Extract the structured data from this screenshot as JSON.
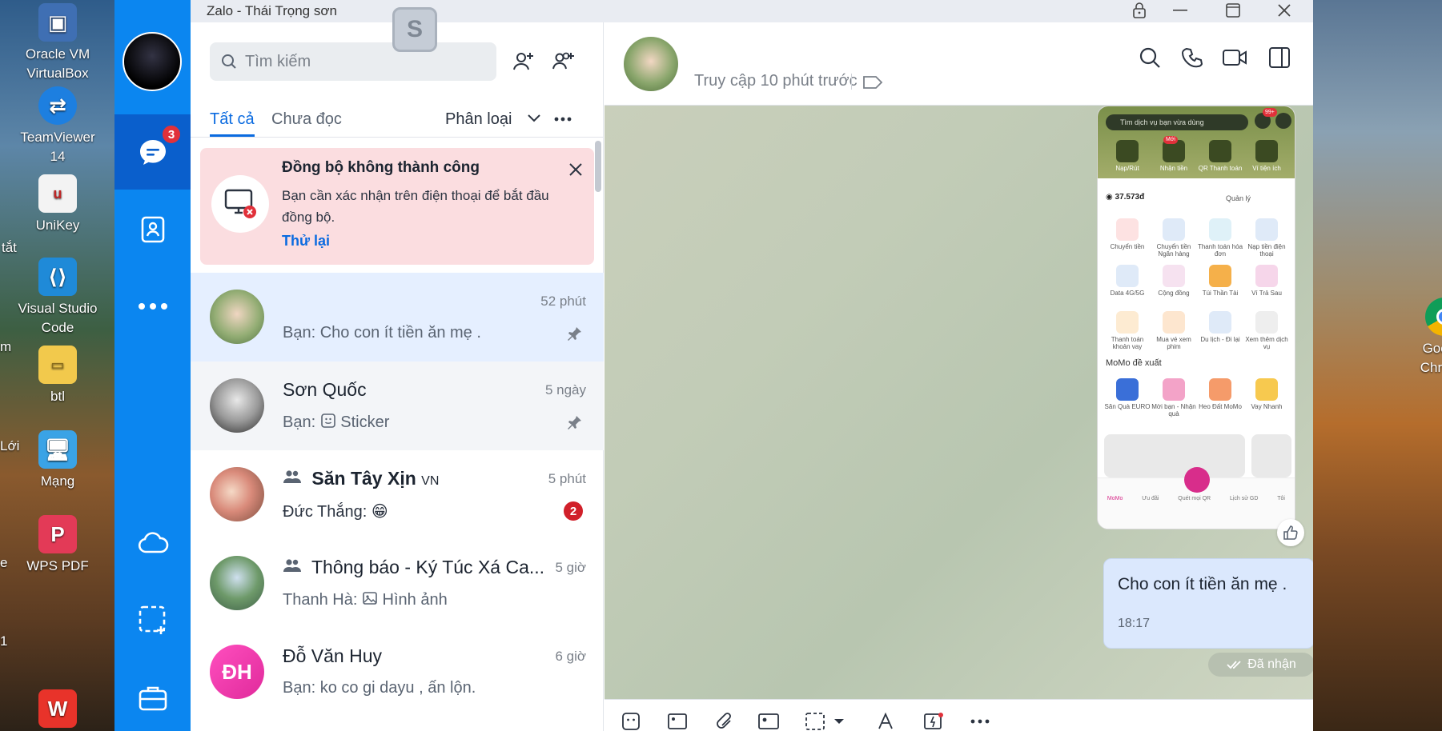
{
  "window": {
    "title": "Zalo - Thái Trọng sơn"
  },
  "desktop": {
    "left_icons": [
      {
        "label": "Oracle VM VirtualBox",
        "icon": "virtualbox-icon"
      },
      {
        "label": "TeamViewer 14",
        "icon": "teamviewer-icon"
      },
      {
        "label": "UniKey",
        "icon": "unikey-icon"
      },
      {
        "label": "Visual Studio Code",
        "icon": "vscode-icon"
      },
      {
        "label": "btl",
        "icon": "folder-icon"
      },
      {
        "label": "Mạng",
        "icon": "network-icon"
      },
      {
        "label": "WPS PDF",
        "icon": "wps-pdf-icon"
      },
      {
        "label": "",
        "icon": "wps-office-icon"
      }
    ],
    "edge_labels": [
      "tắt",
      "m",
      "Lới",
      "e",
      "1"
    ],
    "right_icon": {
      "label": "Google Chrome",
      "icon": "chrome-icon"
    }
  },
  "rail": {
    "messages_badge": "3"
  },
  "search": {
    "placeholder": "Tìm kiếm"
  },
  "tabs": {
    "all": "Tất cả",
    "unread": "Chưa đọc",
    "classify": "Phân loại"
  },
  "alert": {
    "title": "Đồng bộ không thành công",
    "text": "Bạn cần xác nhận trên điện thoại để bắt đầu đồng bộ.",
    "retry": "Thử lại"
  },
  "conversations": [
    {
      "name": "",
      "time": "52 phút",
      "preview": "Bạn: Cho con ít tiền ăn mẹ .",
      "pinned": true
    },
    {
      "name": "Sơn  Quốc",
      "time": "5 ngày",
      "preview_prefix": "Bạn: ",
      "preview": "Sticker",
      "pinned": true
    },
    {
      "name": "Săn Tây Xịn",
      "name_suffix": "VN",
      "time": "5 phút",
      "preview": "Đức Thắng: 😁",
      "unread": "2",
      "group": true
    },
    {
      "name": "Thông báo - Ký Túc Xá Ca...",
      "time": "5 giờ",
      "preview_prefix": "Thanh Hà: ",
      "preview": "Hình ảnh",
      "group": true
    },
    {
      "name": "Đỗ Văn Huy",
      "initials": "ĐH",
      "time": "6 giờ",
      "preview": "Bạn: ko co gi dayu , ấn lộn."
    }
  ],
  "chat": {
    "status": "Truy cập 10 phút trước",
    "message_text": "Cho con ít tiền ăn mẹ .",
    "message_time": "18:17",
    "received_label": "Đã nhận"
  },
  "phone_screenshot": {
    "search": "Tìm dịch vụ bạn vừa dùng",
    "notif_badge": "99+",
    "top_items": [
      "Nạp/Rút",
      "Nhận tiền",
      "QR Thanh toán",
      "Ví tiện ích"
    ],
    "new_badge": "Mới",
    "balance": "37.573đ",
    "manage": "Quản lý",
    "grid_items": [
      "Chuyển tiền",
      "Chuyển tiền Ngân hàng",
      "Thanh toán hóa đơn",
      "Nạp tiền điện thoại",
      "Data 4G/5G",
      "Cộng đồng",
      "Túi Thần Tài",
      "Ví Trả Sau",
      "Thanh toán khoản vay",
      "Mua vé xem phim",
      "Du lịch - Đi lại",
      "Xem thêm dịch vụ"
    ],
    "section_title": "MoMo đề xuất",
    "suggest_items": [
      "Săn Quà EURO",
      "Mời bạn - Nhận quà",
      "Heo Đất MoMo",
      "Vay Nhanh"
    ],
    "bottom_tabs": [
      "MoMo",
      "Ưu đãi",
      "Quét mọi QR",
      "Lịch sử GD",
      "Tôi"
    ]
  },
  "colors": {
    "rail": "#0b86f0",
    "accent": "#0b6be0",
    "alert_bg": "#fbdde0",
    "badge": "#e1313a"
  }
}
